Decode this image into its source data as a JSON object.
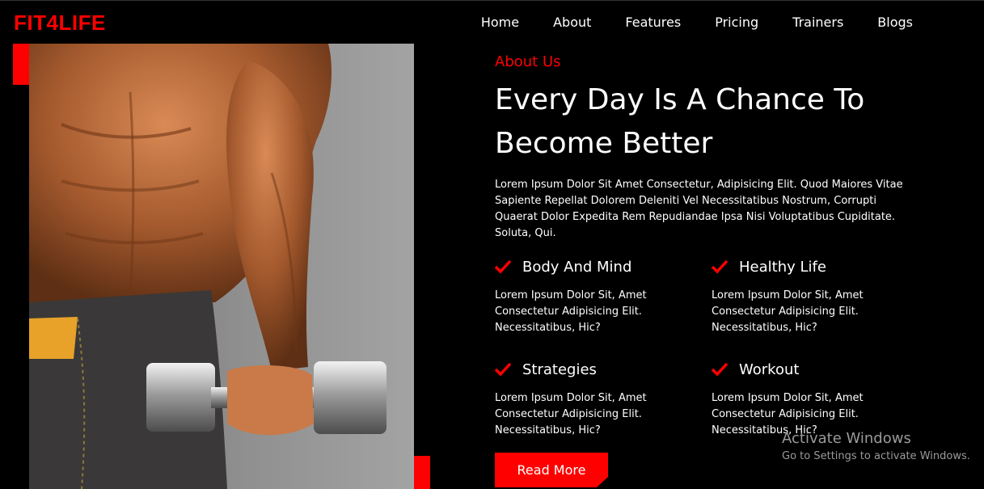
{
  "brand": {
    "logo_left": "FIT",
    "logo_mid": "4",
    "logo_right": "LIFE",
    "accent": "#ff0000"
  },
  "nav": {
    "items": [
      "Home",
      "About",
      "Features",
      "Pricing",
      "Trainers",
      "Blogs"
    ]
  },
  "about": {
    "eyebrow": "About Us",
    "headline": "Every Day Is A Chance To Become Better",
    "intro": "Lorem Ipsum Dolor Sit Amet Consectetur, Adipisicing Elit. Quod Maiores Vitae Sapiente Repellat Dolorem Deleniti Vel Necessitatibus Nostrum, Corrupti Quaerat Dolor Expedita Rem Repudiandae Ipsa Nisi Voluptatibus Cupiditate. Soluta, Qui."
  },
  "features": [
    {
      "title": "Body And Mind",
      "desc": "Lorem Ipsum Dolor Sit, Amet Consectetur Adipisicing Elit. Necessitatibus, Hic?"
    },
    {
      "title": "Healthy Life",
      "desc": "Lorem Ipsum Dolor Sit, Amet Consectetur Adipisicing Elit. Necessitatibus, Hic?"
    },
    {
      "title": "Strategies",
      "desc": "Lorem Ipsum Dolor Sit, Amet Consectetur Adipisicing Elit. Necessitatibus, Hic?"
    },
    {
      "title": "Workout",
      "desc": "Lorem Ipsum Dolor Sit, Amet Consectetur Adipisicing Elit. Necessitatibus, Hic?"
    }
  ],
  "cta": {
    "label": "Read More"
  },
  "watermark": {
    "title": "Activate Windows",
    "subtitle": "Go to Settings to activate Windows."
  },
  "icons": {
    "check": "check-icon"
  }
}
